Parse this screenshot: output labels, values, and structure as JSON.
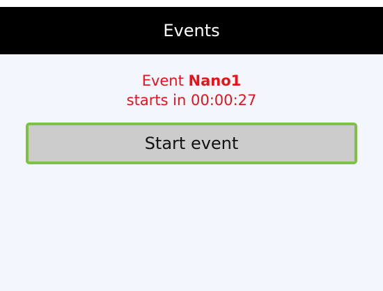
{
  "header": {
    "title": "Events"
  },
  "event": {
    "prefix": "Event",
    "name": "Nano1",
    "countdown_text": "starts in 00:00:27"
  },
  "actions": {
    "start_label": "Start event"
  },
  "colors": {
    "header_bg": "#000000",
    "alert_text": "#e8131a",
    "button_bg": "#cccccc",
    "button_border": "#7dc242",
    "screen_bg": "#f4f6fd"
  }
}
